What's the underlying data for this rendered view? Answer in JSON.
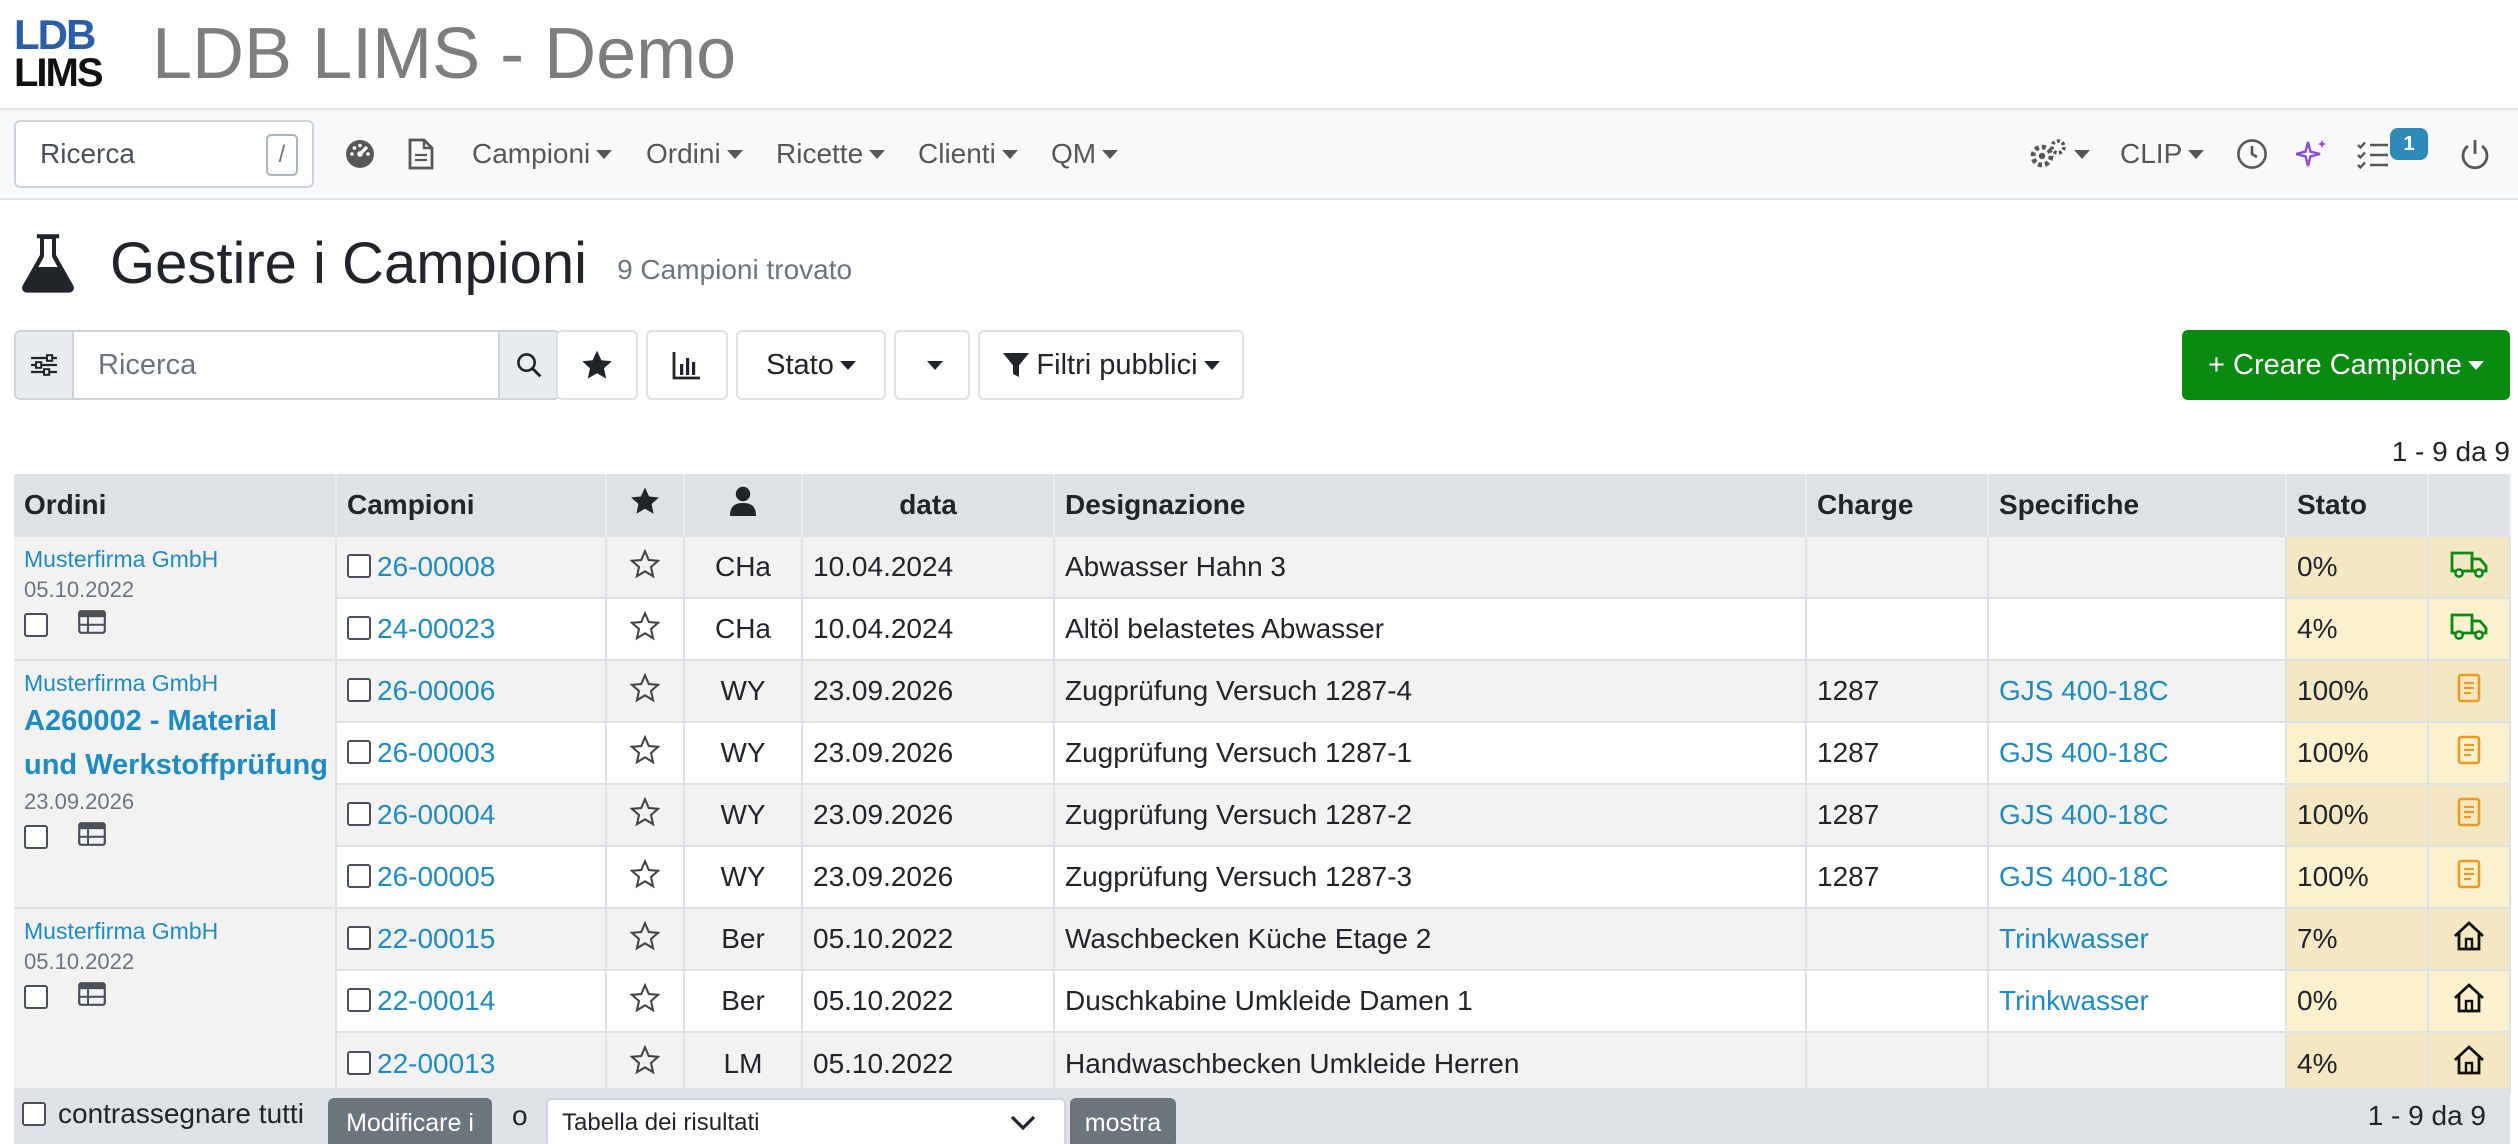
{
  "app": {
    "logo_line1": "LDB",
    "logo_line2": "LIMS",
    "title": "LDB LIMS - Demo"
  },
  "navbar": {
    "search_placeholder": "Ricerca",
    "search_shortcut": "/",
    "menus": [
      "Campioni",
      "Ordini",
      "Ricette",
      "Clienti",
      "QM"
    ],
    "clip_label": "CLIP",
    "tasks_badge": "1"
  },
  "page": {
    "title": "Gestire i Campioni",
    "subtitle": "9 Campioni trovato"
  },
  "toolbar": {
    "search_placeholder": "Ricerca",
    "stato_label": "Stato",
    "public_filters_label": "Filtri pubblici",
    "create_label": "+ Creare Campione"
  },
  "pagination": "1 - 9 da 9",
  "table": {
    "headers": {
      "orders": "Ordini",
      "samples": "Campioni",
      "date": "data",
      "designation": "Designazione",
      "charge": "Charge",
      "specs": "Specifiche",
      "status": "Stato"
    },
    "orders": [
      {
        "customer": "Musterfirma GmbH",
        "title": "",
        "date": "05.10.2022"
      },
      {
        "customer": "Musterfirma GmbH",
        "title": "A260002 - Material und Werkstoffprüfung",
        "date": "23.09.2026"
      },
      {
        "customer": "Musterfirma GmbH",
        "title": "",
        "date": "05.10.2022"
      }
    ],
    "rows": [
      {
        "id": "26-00008",
        "user": "CHa",
        "date": "10.04.2024",
        "designation": "Abwasser Hahn 3",
        "charge": "",
        "spec": "",
        "status": "0%",
        "status_icon": "truck-icon"
      },
      {
        "id": "24-00023",
        "user": "CHa",
        "date": "10.04.2024",
        "designation": "Altöl belastetes Abwasser",
        "charge": "",
        "spec": "",
        "status": "4%",
        "status_icon": "truck-icon"
      },
      {
        "id": "26-00006",
        "user": "WY",
        "date": "23.09.2026",
        "designation": "Zugprüfung Versuch 1287-4",
        "charge": "1287",
        "spec": "GJS 400-18C",
        "status": "100%",
        "status_icon": "report-icon"
      },
      {
        "id": "26-00003",
        "user": "WY",
        "date": "23.09.2026",
        "designation": "Zugprüfung Versuch 1287-1",
        "charge": "1287",
        "spec": "GJS 400-18C",
        "status": "100%",
        "status_icon": "report-icon"
      },
      {
        "id": "26-00004",
        "user": "WY",
        "date": "23.09.2026",
        "designation": "Zugprüfung Versuch 1287-2",
        "charge": "1287",
        "spec": "GJS 400-18C",
        "status": "100%",
        "status_icon": "report-icon"
      },
      {
        "id": "26-00005",
        "user": "WY",
        "date": "23.09.2026",
        "designation": "Zugprüfung Versuch 1287-3",
        "charge": "1287",
        "spec": "GJS 400-18C",
        "status": "100%",
        "status_icon": "report-icon"
      },
      {
        "id": "22-00015",
        "user": "Ber",
        "date": "05.10.2022",
        "designation": "Waschbecken Küche Etage 2",
        "charge": "",
        "spec": "Trinkwasser",
        "status": "7%",
        "status_icon": "home-icon"
      },
      {
        "id": "22-00014",
        "user": "Ber",
        "date": "05.10.2022",
        "designation": "Duschkabine Umkleide Damen 1",
        "charge": "",
        "spec": "Trinkwasser",
        "status": "0%",
        "status_icon": "home-icon"
      },
      {
        "id": "22-00013",
        "user": "LM",
        "date": "05.10.2022",
        "designation": "Handwaschbecken Umkleide Herren",
        "charge": "",
        "spec": "",
        "status": "4%",
        "status_icon": "home-icon"
      }
    ]
  },
  "footer": {
    "select_all": "contrassegnare tutti",
    "edit_button": "Modificare i",
    "or": "o",
    "result_table": "Tabella dei risultati",
    "show_button": "mostra",
    "pagination": "1 - 9 da 9"
  },
  "colors": {
    "brand_green": "#0a8a10",
    "link_blue": "#1e8bc3",
    "status_bg": "#fcf1cf",
    "badge_blue": "#2e8bb8"
  }
}
